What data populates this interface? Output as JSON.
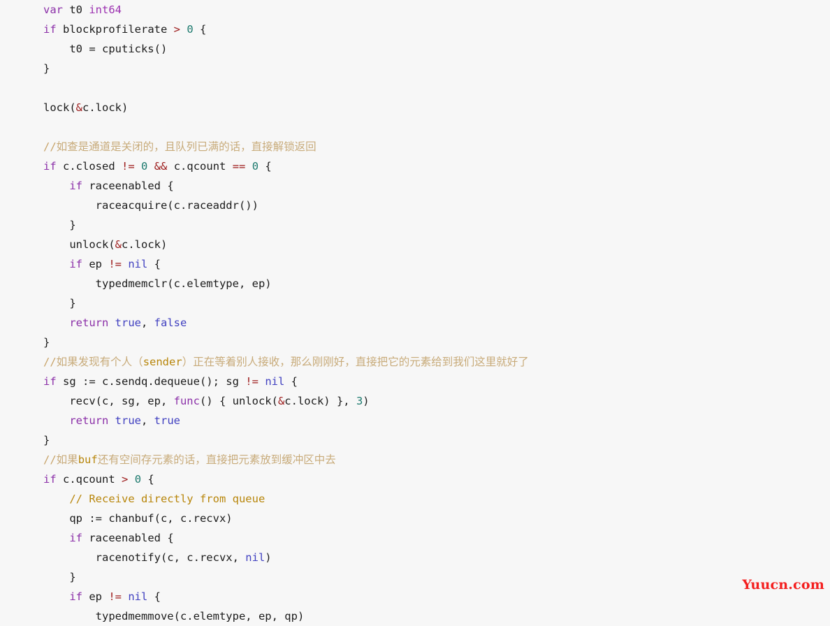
{
  "editor": {
    "background_color": "#f7f7f7",
    "font_size_px": 15.5,
    "line_height_px": 28,
    "language": "go",
    "colors": {
      "text": "#1b1b1b",
      "keyword": "#8b2fa8",
      "type": "#9b30b0",
      "constant": "#4040c0",
      "number": "#1d7a6e",
      "operator": "#9c1a1a",
      "comment": "#c8ab7a",
      "comment_latin": "#b8860b",
      "watermark": "#f41f1f"
    }
  },
  "watermark": {
    "text": "Yuucn.com"
  },
  "code": {
    "lines": [
      {
        "n": 1,
        "indent": 0,
        "text": "var t0 int64"
      },
      {
        "n": 2,
        "indent": 0,
        "text": "if blockprofilerate > 0 {"
      },
      {
        "n": 3,
        "indent": 1,
        "text": "t0 = cputicks()"
      },
      {
        "n": 4,
        "indent": 0,
        "text": "}"
      },
      {
        "n": 5,
        "indent": 0,
        "text": ""
      },
      {
        "n": 6,
        "indent": 0,
        "text": "lock(&c.lock)"
      },
      {
        "n": 7,
        "indent": 0,
        "text": ""
      },
      {
        "n": 8,
        "indent": 0,
        "text": "//如查是通道是关闭的，且队列已满的话，直接解锁返回"
      },
      {
        "n": 9,
        "indent": 0,
        "text": "if c.closed != 0 && c.qcount == 0 {"
      },
      {
        "n": 10,
        "indent": 1,
        "text": "if raceenabled {"
      },
      {
        "n": 11,
        "indent": 2,
        "text": "raceacquire(c.raceaddr())"
      },
      {
        "n": 12,
        "indent": 1,
        "text": "}"
      },
      {
        "n": 13,
        "indent": 1,
        "text": "unlock(&c.lock)"
      },
      {
        "n": 14,
        "indent": 1,
        "text": "if ep != nil {"
      },
      {
        "n": 15,
        "indent": 2,
        "text": "typedmemclr(c.elemtype, ep)"
      },
      {
        "n": 16,
        "indent": 1,
        "text": "}"
      },
      {
        "n": 17,
        "indent": 1,
        "text": "return true, false"
      },
      {
        "n": 18,
        "indent": 0,
        "text": "}"
      },
      {
        "n": 19,
        "indent": 0,
        "text": "//如果发现有个人（sender）正在等着别人接收，那么刚刚好，直接把它的元素给到我们这里就好了"
      },
      {
        "n": 20,
        "indent": 0,
        "text": "if sg := c.sendq.dequeue(); sg != nil {"
      },
      {
        "n": 21,
        "indent": 1,
        "text": "recv(c, sg, ep, func() { unlock(&c.lock) }, 3)"
      },
      {
        "n": 22,
        "indent": 1,
        "text": "return true, true"
      },
      {
        "n": 23,
        "indent": 0,
        "text": "}"
      },
      {
        "n": 24,
        "indent": 0,
        "text": "//如果buf还有空间存元素的话，直接把元素放到缓冲区中去"
      },
      {
        "n": 25,
        "indent": 0,
        "text": "if c.qcount > 0 {"
      },
      {
        "n": 26,
        "indent": 1,
        "text": "// Receive directly from queue"
      },
      {
        "n": 27,
        "indent": 1,
        "text": "qp := chanbuf(c, c.recvx)"
      },
      {
        "n": 28,
        "indent": 1,
        "text": "if raceenabled {"
      },
      {
        "n": 29,
        "indent": 2,
        "text": "racenotify(c, c.recvx, nil)"
      },
      {
        "n": 30,
        "indent": 1,
        "text": "}"
      },
      {
        "n": 31,
        "indent": 1,
        "text": "if ep != nil {"
      },
      {
        "n": 32,
        "indent": 2,
        "text": "typedmemmove(c.elemtype, ep, qp)"
      }
    ]
  }
}
